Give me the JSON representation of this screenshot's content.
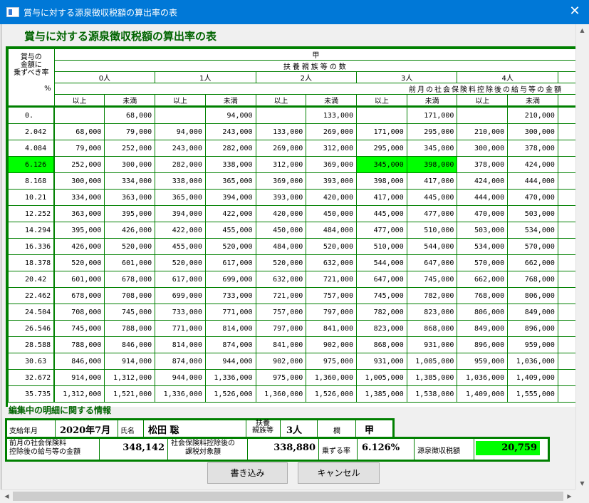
{
  "window": {
    "title": "賞与に対する源泉徴収税額の算出率の表"
  },
  "heading": "賞与に対する源泉徴収税額の算出率の表",
  "table": {
    "corner_lines": [
      "賞与の",
      "金額に",
      "乗ずべき率"
    ],
    "corner_pct": "%",
    "group_label": "甲",
    "dependents_label": "扶養親族等の数",
    "dependents": [
      "0人",
      "1人",
      "2人",
      "3人",
      "4人"
    ],
    "income_label": "前月の社会保険料控除後の給与等の金額",
    "col_from": "以上",
    "col_to": "未満",
    "rows": [
      {
        "rate": "0.",
        "v": [
          "",
          "68,000",
          "",
          "94,000",
          "",
          "133,000",
          "",
          "171,000",
          "",
          "210,000"
        ]
      },
      {
        "rate": "2.042",
        "v": [
          "68,000",
          "79,000",
          "94,000",
          "243,000",
          "133,000",
          "269,000",
          "171,000",
          "295,000",
          "210,000",
          "300,000"
        ]
      },
      {
        "rate": "4.084",
        "v": [
          "79,000",
          "252,000",
          "243,000",
          "282,000",
          "269,000",
          "312,000",
          "295,000",
          "345,000",
          "300,000",
          "378,000"
        ]
      },
      {
        "rate": "6.126",
        "v": [
          "252,000",
          "300,000",
          "282,000",
          "338,000",
          "312,000",
          "369,000",
          "345,000",
          "398,000",
          "378,000",
          "424,000"
        ],
        "hl": true
      },
      {
        "rate": "8.168",
        "v": [
          "300,000",
          "334,000",
          "338,000",
          "365,000",
          "369,000",
          "393,000",
          "398,000",
          "417,000",
          "424,000",
          "444,000"
        ]
      },
      {
        "rate": "10.21",
        "v": [
          "334,000",
          "363,000",
          "365,000",
          "394,000",
          "393,000",
          "420,000",
          "417,000",
          "445,000",
          "444,000",
          "470,000"
        ]
      },
      {
        "rate": "12.252",
        "v": [
          "363,000",
          "395,000",
          "394,000",
          "422,000",
          "420,000",
          "450,000",
          "445,000",
          "477,000",
          "470,000",
          "503,000"
        ]
      },
      {
        "rate": "14.294",
        "v": [
          "395,000",
          "426,000",
          "422,000",
          "455,000",
          "450,000",
          "484,000",
          "477,000",
          "510,000",
          "503,000",
          "534,000"
        ]
      },
      {
        "rate": "16.336",
        "v": [
          "426,000",
          "520,000",
          "455,000",
          "520,000",
          "484,000",
          "520,000",
          "510,000",
          "544,000",
          "534,000",
          "570,000"
        ]
      },
      {
        "rate": "18.378",
        "v": [
          "520,000",
          "601,000",
          "520,000",
          "617,000",
          "520,000",
          "632,000",
          "544,000",
          "647,000",
          "570,000",
          "662,000"
        ]
      },
      {
        "rate": "20.42",
        "v": [
          "601,000",
          "678,000",
          "617,000",
          "699,000",
          "632,000",
          "721,000",
          "647,000",
          "745,000",
          "662,000",
          "768,000"
        ]
      },
      {
        "rate": "22.462",
        "v": [
          "678,000",
          "708,000",
          "699,000",
          "733,000",
          "721,000",
          "757,000",
          "745,000",
          "782,000",
          "768,000",
          "806,000"
        ]
      },
      {
        "rate": "24.504",
        "v": [
          "708,000",
          "745,000",
          "733,000",
          "771,000",
          "757,000",
          "797,000",
          "782,000",
          "823,000",
          "806,000",
          "849,000"
        ]
      },
      {
        "rate": "26.546",
        "v": [
          "745,000",
          "788,000",
          "771,000",
          "814,000",
          "797,000",
          "841,000",
          "823,000",
          "868,000",
          "849,000",
          "896,000"
        ]
      },
      {
        "rate": "28.588",
        "v": [
          "788,000",
          "846,000",
          "814,000",
          "874,000",
          "841,000",
          "902,000",
          "868,000",
          "931,000",
          "896,000",
          "959,000"
        ]
      },
      {
        "rate": "30.63",
        "v": [
          "846,000",
          "914,000",
          "874,000",
          "944,000",
          "902,000",
          "975,000",
          "931,000",
          "1,005,000",
          "959,000",
          "1,036,000"
        ]
      },
      {
        "rate": "32.672",
        "v": [
          "914,000",
          "1,312,000",
          "944,000",
          "1,336,000",
          "975,000",
          "1,360,000",
          "1,005,000",
          "1,385,000",
          "1,036,000",
          "1,409,000"
        ]
      },
      {
        "rate": "35.735",
        "v": [
          "1,312,000",
          "1,521,000",
          "1,336,000",
          "1,526,000",
          "1,360,000",
          "1,526,000",
          "1,385,000",
          "1,538,000",
          "1,409,000",
          "1,555,000"
        ]
      }
    ]
  },
  "info": {
    "section_title": "編集中の明細に関する情報",
    "pay_month_label": "支給年月",
    "pay_month": "2020年7月",
    "name_label": "氏名",
    "name": "松田 聡",
    "dependents_label_1": "扶養",
    "dependents_label_2": "親族等",
    "dependents_value": "3人",
    "column_label": "欄",
    "column_value": "甲",
    "prev_income_label_1": "前月の社会保険料",
    "prev_income_label_2": "控除後の給与等の金額",
    "prev_income": "348,142",
    "taxable_label_1": "社会保険料控除後の",
    "taxable_label_2": "課税対象額",
    "taxable": "338,880",
    "rate_label": "乗ずる率",
    "rate": "6.126%",
    "tax_label": "源泉徴収税額",
    "tax": "20,759"
  },
  "buttons": {
    "write": "書き込み",
    "cancel": "キャンセル"
  },
  "colors": {
    "accent_green": "#008000",
    "highlight": "#00ff00",
    "titlebar": "#0078d7"
  }
}
